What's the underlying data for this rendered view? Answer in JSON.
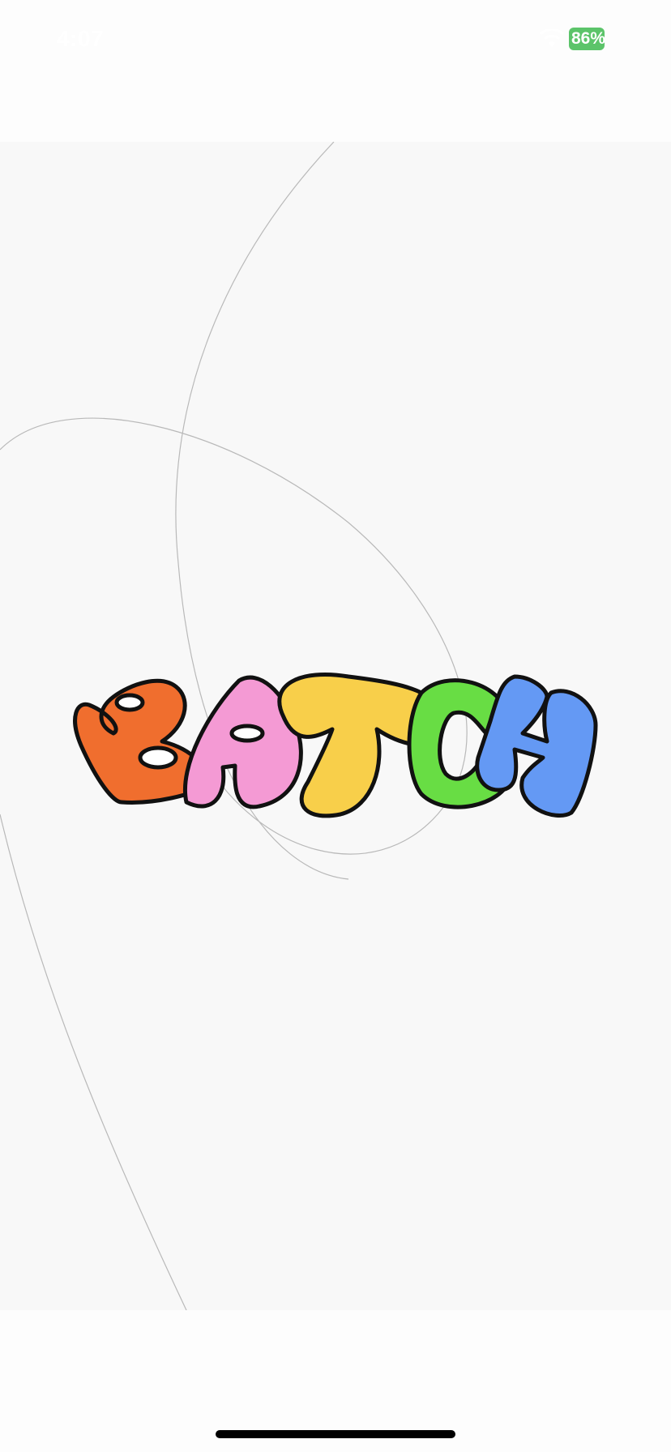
{
  "status_bar": {
    "time": "4:07",
    "battery_level": "86%",
    "battery_color": "#5cc46a",
    "wifi_icon": "wifi-icon"
  },
  "splash": {
    "logo_text": "BATCH",
    "letter_colors": {
      "B": "#f06e2e",
      "A": "#f49ad4",
      "T": "#f8cf4a",
      "C": "#68dd44",
      "H": "#6499f4"
    },
    "outline_color": "#111111"
  },
  "home_indicator": {
    "color": "#000000"
  }
}
